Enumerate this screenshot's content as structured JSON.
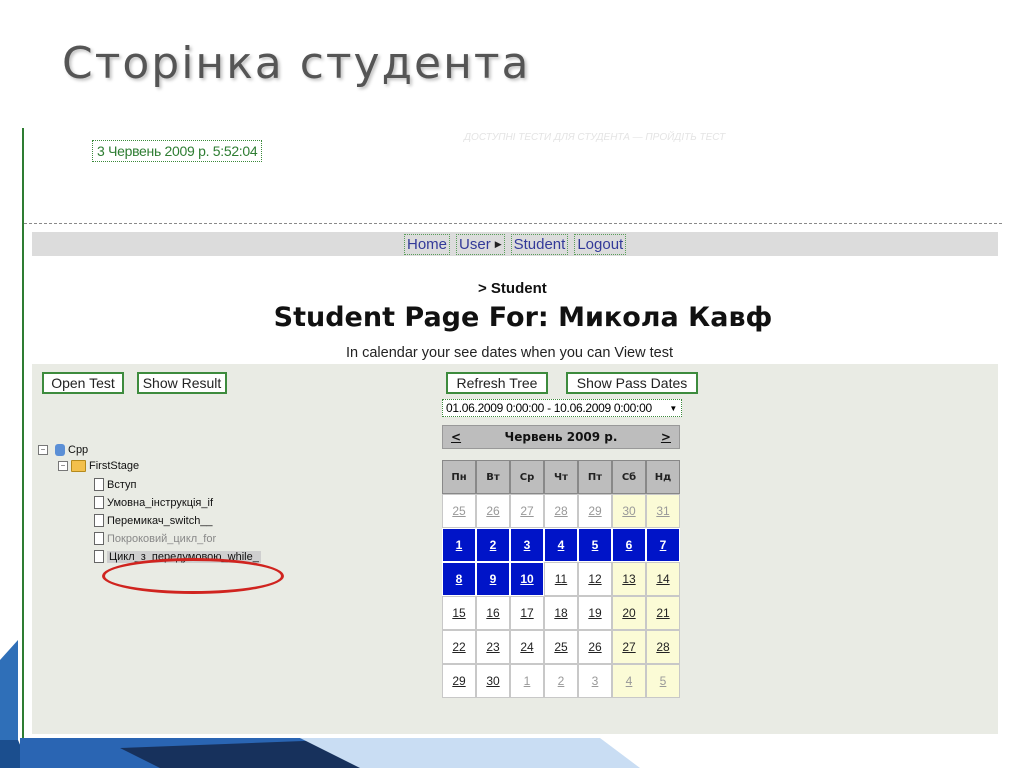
{
  "slide": {
    "title": "Сторінка студента"
  },
  "header": {
    "date_time": "3 Червень 2009 р. 5:52:04",
    "faint_text": "ДОСТУПНІ ТЕСТИ ДЛЯ СТУДЕНТА — ПРОЙДІТЬ ТЕСТ"
  },
  "nav": {
    "items": [
      "Home",
      "User",
      "Student",
      "Logout"
    ]
  },
  "breadcrumb": "> Student",
  "page_title": "Student Page For: Микола Кавф",
  "hint": "In calendar your see dates when you can View test",
  "buttons": {
    "open_test": "Open Test",
    "show_result": "Show Result",
    "refresh_tree": "Refresh Tree",
    "show_pass_dates": "Show Pass Dates"
  },
  "tree": {
    "root": "Cpp",
    "stage": "FirstStage",
    "items": [
      "Вступ",
      "Умовна_інструкція_if",
      "Перемикач_switch__",
      "Покроковий_цикл_for",
      "Цикл_з_передумовою_while_"
    ]
  },
  "date_range": "01.06.2009 0:00:00 - 10.06.2009 0:00:00",
  "calendar": {
    "month_label": "Червень 2009 р.",
    "prev": "<",
    "next": ">",
    "days_of_week": [
      "Пн",
      "Вт",
      "Ср",
      "Чт",
      "Пт",
      "Сб",
      "Нд"
    ],
    "weeks": [
      [
        "25",
        "26",
        "27",
        "28",
        "29",
        "30",
        "31"
      ],
      [
        "1",
        "2",
        "3",
        "4",
        "5",
        "6",
        "7"
      ],
      [
        "8",
        "9",
        "10",
        "11",
        "12",
        "13",
        "14"
      ],
      [
        "15",
        "16",
        "17",
        "18",
        "19",
        "20",
        "21"
      ],
      [
        "22",
        "23",
        "24",
        "25",
        "26",
        "27",
        "28"
      ],
      [
        "29",
        "30",
        "1",
        "2",
        "3",
        "4",
        "5"
      ]
    ]
  },
  "colors": {
    "accent_green": "#2e7d32",
    "selected_blue": "#0014c8",
    "weekend": "#fbfbd6",
    "highlight_ring": "#d0241f"
  }
}
